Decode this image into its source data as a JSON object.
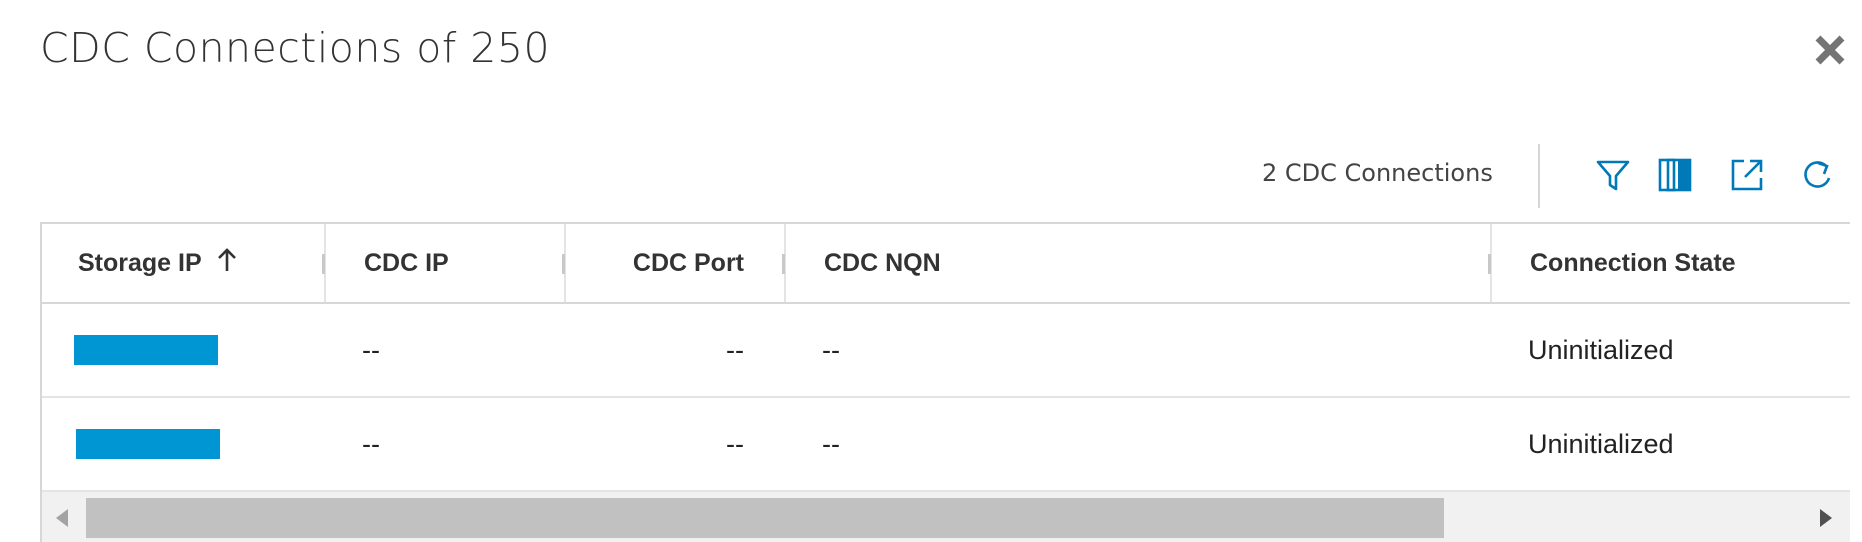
{
  "dialog": {
    "title": "CDC Connections of 250",
    "close_icon": "close-icon"
  },
  "toolbar": {
    "count_label": "2 CDC Connections",
    "icons": [
      "filter-icon",
      "columns-icon",
      "export-icon",
      "refresh-icon"
    ]
  },
  "accent_color": "#0095d3",
  "table": {
    "columns": [
      "Storage IP",
      "CDC IP",
      "CDC Port",
      "CDC NQN",
      "Connection State"
    ],
    "sort": {
      "column": "Storage IP",
      "direction": "ascending"
    },
    "rows": [
      {
        "storage_ip": "",
        "cdc_ip": "--",
        "cdc_port": "--",
        "cdc_nqn": "--",
        "state": "Uninitialized"
      },
      {
        "storage_ip": "",
        "cdc_ip": "--",
        "cdc_port": "--",
        "cdc_nqn": "--",
        "state": "Uninitialized"
      }
    ]
  }
}
